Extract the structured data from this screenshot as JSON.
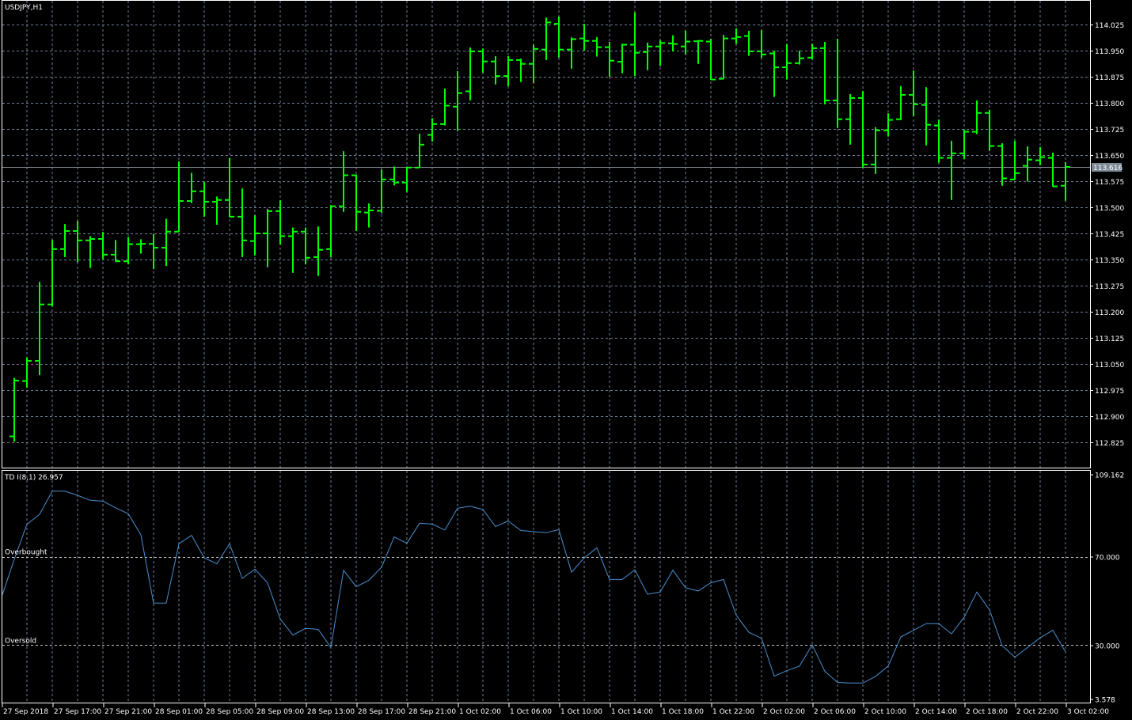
{
  "chart_data": [
    {
      "type": "ohlc",
      "title": "USDJPY,H1",
      "symbol": "USDJPY",
      "timeframe": "H1",
      "bar_color": "#00ff00",
      "current_price": "113.616",
      "current_price_value": 113.616,
      "ylim": [
        112.825,
        114.025
      ],
      "y_ticks": [
        "114.025",
        "113.950",
        "113.875",
        "113.800",
        "113.725",
        "113.650",
        "113.575",
        "113.500",
        "113.425",
        "113.350",
        "113.275",
        "113.200",
        "113.125",
        "113.050",
        "112.975",
        "112.900",
        "112.825"
      ],
      "ohlc": [
        [
          112.842,
          113.01,
          112.827,
          113.002
        ],
        [
          113.001,
          113.069,
          112.982,
          113.059
        ],
        [
          113.059,
          113.286,
          113.018,
          113.221
        ],
        [
          113.221,
          113.406,
          113.215,
          113.38
        ],
        [
          113.38,
          113.452,
          113.357,
          113.432
        ],
        [
          113.432,
          113.461,
          113.342,
          113.405
        ],
        [
          113.405,
          113.417,
          113.326,
          113.409
        ],
        [
          113.409,
          113.429,
          113.351,
          113.364
        ],
        [
          113.364,
          113.406,
          113.344,
          113.345
        ],
        [
          113.345,
          113.415,
          113.336,
          113.394
        ],
        [
          113.394,
          113.408,
          113.367,
          113.395
        ],
        [
          113.395,
          113.423,
          113.323,
          113.384
        ],
        [
          113.384,
          113.467,
          113.332,
          113.43
        ],
        [
          113.43,
          113.632,
          113.429,
          113.518
        ],
        [
          113.518,
          113.599,
          113.512,
          113.546
        ],
        [
          113.546,
          113.573,
          113.473,
          113.516
        ],
        [
          113.516,
          113.531,
          113.45,
          113.521
        ],
        [
          113.521,
          113.641,
          113.472,
          113.473
        ],
        [
          113.473,
          113.554,
          113.357,
          113.405
        ],
        [
          113.403,
          113.477,
          113.362,
          113.425
        ],
        [
          113.425,
          113.495,
          113.328,
          113.489
        ],
        [
          113.489,
          113.52,
          113.393,
          113.417
        ],
        [
          113.417,
          113.442,
          113.312,
          113.43
        ],
        [
          113.43,
          113.442,
          113.336,
          113.355
        ],
        [
          113.357,
          113.445,
          113.303,
          113.378
        ],
        [
          113.38,
          113.506,
          113.357,
          113.503
        ],
        [
          113.503,
          113.661,
          113.487,
          113.592
        ],
        [
          113.592,
          113.594,
          113.432,
          113.487
        ],
        [
          113.485,
          113.511,
          113.442,
          113.491
        ],
        [
          113.49,
          113.609,
          113.483,
          113.58
        ],
        [
          113.58,
          113.617,
          113.563,
          113.571
        ],
        [
          113.571,
          113.617,
          113.544,
          113.614
        ],
        [
          113.614,
          113.711,
          113.614,
          113.68
        ],
        [
          113.708,
          113.756,
          113.689,
          113.739
        ],
        [
          113.739,
          113.841,
          113.735,
          113.792
        ],
        [
          113.789,
          113.891,
          113.719,
          113.828
        ],
        [
          113.833,
          113.959,
          113.807,
          113.948
        ],
        [
          113.948,
          113.956,
          113.887,
          113.919
        ],
        [
          113.919,
          113.934,
          113.853,
          113.877
        ],
        [
          113.877,
          113.934,
          113.848,
          113.923
        ],
        [
          113.923,
          113.927,
          113.86,
          113.912
        ],
        [
          113.912,
          113.967,
          113.857,
          113.955
        ],
        [
          113.953,
          114.045,
          113.923,
          114.031
        ],
        [
          114.027,
          114.048,
          113.93,
          113.953
        ],
        [
          113.953,
          113.988,
          113.898,
          113.983
        ],
        [
          113.985,
          114.027,
          113.95,
          113.978
        ],
        [
          113.978,
          113.989,
          113.933,
          113.96
        ],
        [
          113.96,
          113.975,
          113.875,
          113.921
        ],
        [
          113.918,
          113.97,
          113.885,
          113.967
        ],
        [
          113.967,
          114.06,
          113.877,
          113.944
        ],
        [
          113.946,
          113.973,
          113.894,
          113.962
        ],
        [
          113.962,
          113.98,
          113.906,
          113.972
        ],
        [
          113.971,
          113.994,
          113.948,
          113.969
        ],
        [
          113.962,
          114.007,
          113.939,
          113.976
        ],
        [
          113.977,
          113.98,
          113.912,
          113.978
        ],
        [
          113.976,
          113.984,
          113.866,
          113.867
        ],
        [
          113.869,
          113.995,
          113.868,
          113.985
        ],
        [
          113.985,
          114.014,
          113.969,
          113.989
        ],
        [
          113.992,
          114.007,
          113.935,
          113.948
        ],
        [
          113.948,
          114.009,
          113.929,
          113.939
        ],
        [
          113.942,
          113.95,
          113.817,
          113.902
        ],
        [
          113.902,
          113.968,
          113.867,
          113.914
        ],
        [
          113.914,
          113.95,
          113.91,
          113.928
        ],
        [
          113.93,
          113.97,
          113.925,
          113.957
        ],
        [
          113.957,
          113.975,
          113.796,
          113.807
        ],
        [
          113.807,
          113.984,
          113.728,
          113.753
        ],
        [
          113.753,
          113.825,
          113.68,
          113.814
        ],
        [
          113.814,
          113.834,
          113.614,
          113.623
        ],
        [
          113.623,
          113.73,
          113.596,
          113.721
        ],
        [
          113.721,
          113.77,
          113.703,
          113.751
        ],
        [
          113.753,
          113.848,
          113.751,
          113.823
        ],
        [
          113.823,
          113.893,
          113.762,
          113.796
        ],
        [
          113.794,
          113.845,
          113.678,
          113.737
        ],
        [
          113.735,
          113.752,
          113.628,
          113.642
        ],
        [
          113.642,
          113.691,
          113.521,
          113.655
        ],
        [
          113.655,
          113.723,
          113.639,
          113.717
        ],
        [
          113.717,
          113.807,
          113.71,
          113.771
        ],
        [
          113.771,
          113.78,
          113.662,
          113.676
        ],
        [
          113.676,
          113.684,
          113.562,
          113.583
        ],
        [
          113.58,
          113.691,
          113.579,
          113.598
        ],
        [
          113.619,
          113.675,
          113.574,
          113.637
        ],
        [
          113.635,
          113.673,
          113.621,
          113.644
        ],
        [
          113.642,
          113.657,
          113.559,
          113.56
        ],
        [
          113.562,
          113.63,
          113.519,
          113.616
        ]
      ],
      "x_ticks": [
        "27 Sep 2018",
        "27 Sep 17:00",
        "27 Sep 21:00",
        "28 Sep 01:00",
        "28 Sep 05:00",
        "28 Sep 09:00",
        "28 Sep 13:00",
        "28 Sep 17:00",
        "28 Sep 21:00",
        "1 Oct 02:00",
        "1 Oct 06:00",
        "1 Oct 10:00",
        "1 Oct 14:00",
        "1 Oct 18:00",
        "1 Oct 22:00",
        "2 Oct 02:00",
        "2 Oct 06:00",
        "2 Oct 10:00",
        "2 Oct 14:00",
        "2 Oct 18:00",
        "2 Oct 22:00",
        "3 Oct 02:00"
      ],
      "x_tick_every_bars": 4
    },
    {
      "type": "line",
      "title": "TD I(8,1) 26.957",
      "line_color": "#4a8fd0",
      "ylim": [
        3.578,
        109.162
      ],
      "y_ticks": [
        "109.162",
        "70.000",
        "30.000",
        "3.578"
      ],
      "levels": [
        {
          "label": "Overbought",
          "value": 70
        },
        {
          "label": "Oversold",
          "value": 30
        }
      ],
      "first_value_offset_bars": -1,
      "values": [
        52.8,
        68.8,
        84.7,
        89.2,
        99.7,
        99.7,
        97.8,
        95.6,
        95.2,
        92.2,
        89.5,
        79.9,
        49.0,
        49.0,
        75.9,
        79.7,
        69.5,
        66.8,
        75.9,
        60.2,
        64.4,
        58.2,
        41.8,
        34.5,
        37.6,
        37.1,
        28.9,
        63.9,
        56.4,
        59.4,
        65.3,
        79.0,
        76.1,
        85.2,
        84.8,
        82.1,
        92.0,
        92.9,
        91.4,
        83.7,
        86.2,
        81.9,
        81.4,
        80.9,
        82.3,
        63.0,
        69.5,
        74.1,
        59.7,
        59.7,
        64.1,
        53.0,
        54.0,
        63.9,
        56.0,
        54.5,
        58.2,
        59.7,
        43.5,
        35.8,
        33.1,
        16.0,
        18.4,
        20.5,
        30.1,
        18.1,
        13.1,
        12.8,
        12.8,
        15.8,
        20.5,
        33.7,
        36.7,
        39.7,
        39.7,
        35.1,
        42.6,
        54.0,
        46.0,
        29.7,
        24.5,
        28.9,
        33.3,
        36.7,
        26.957
      ]
    }
  ]
}
